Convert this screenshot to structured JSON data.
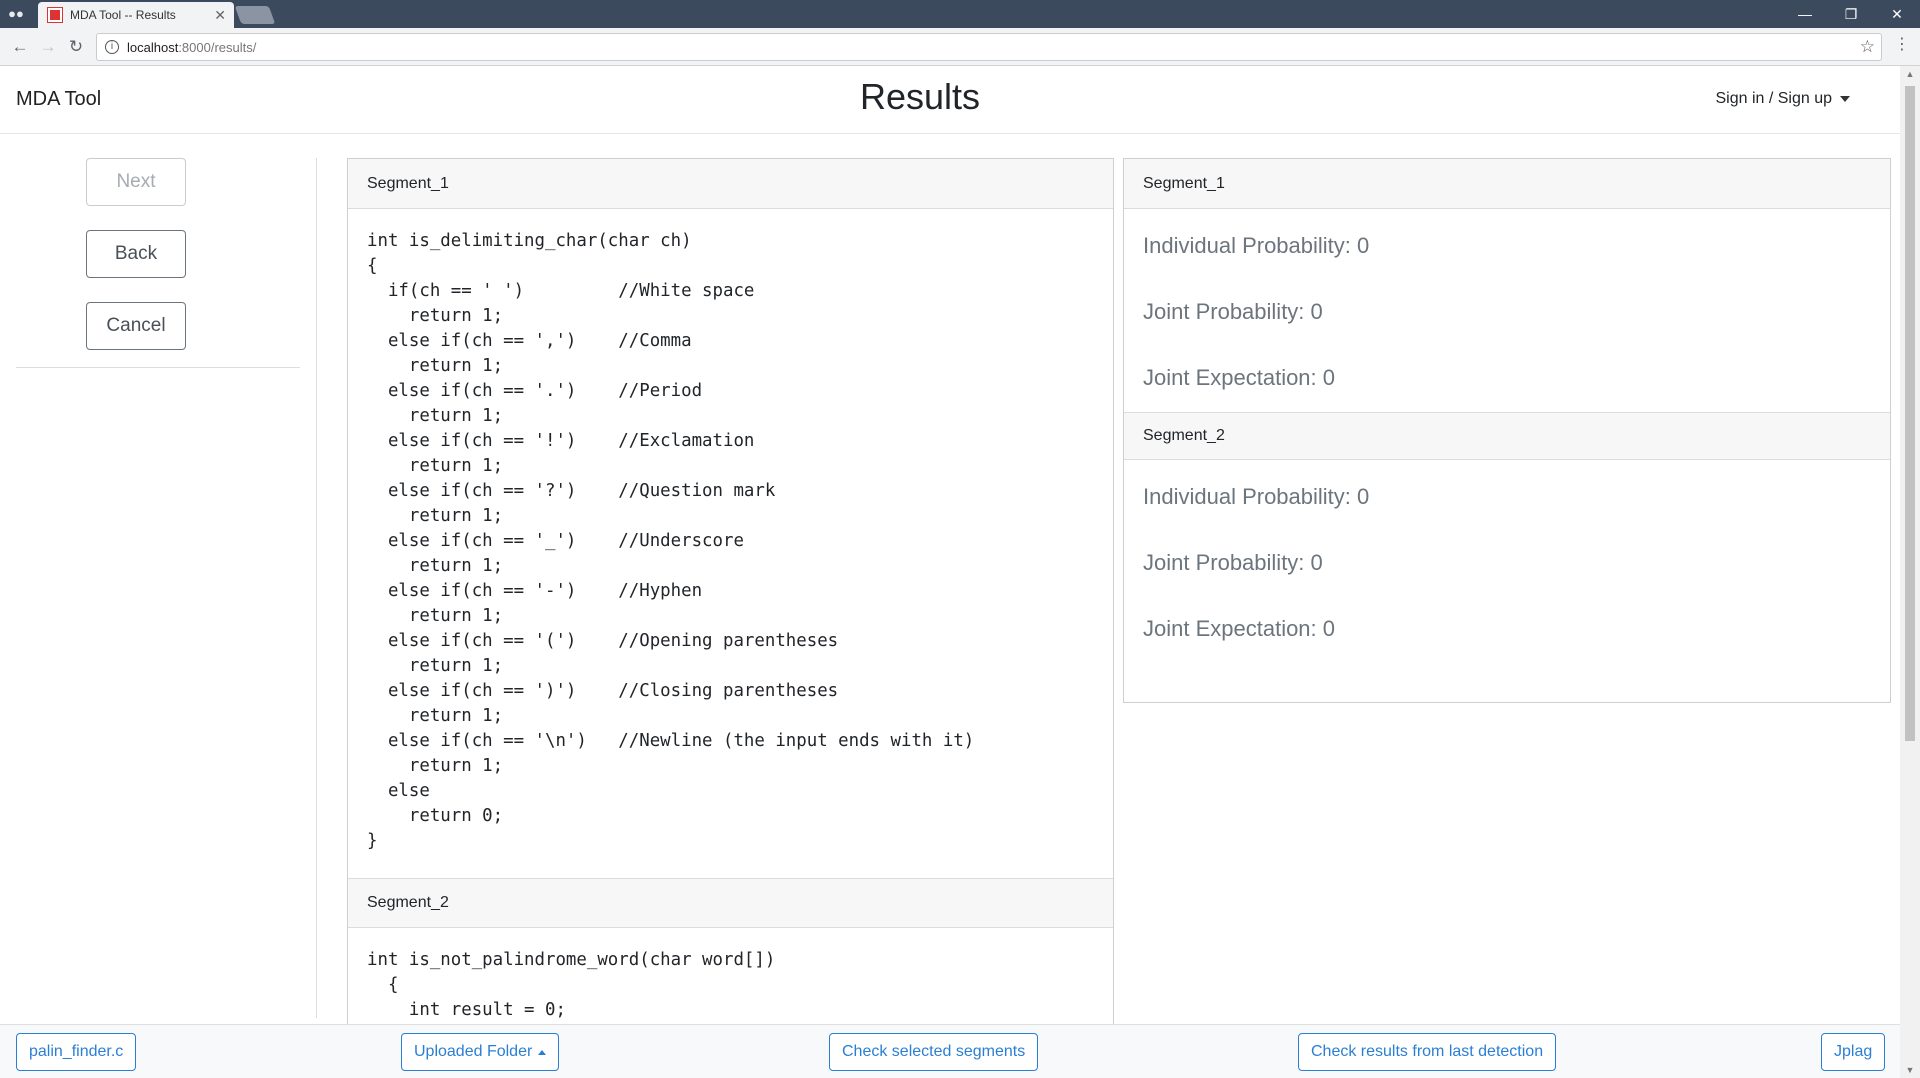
{
  "browser": {
    "tab_title": "MDA Tool -- Results",
    "url_host": "localhost",
    "url_path": ":8000/results/"
  },
  "header": {
    "brand": "MDA Tool",
    "title": "Results",
    "signin": "Sign in / Sign up"
  },
  "sidebar": {
    "next": "Next",
    "back": "Back",
    "cancel": "Cancel"
  },
  "code_panel": {
    "segments": [
      {
        "label": "Segment_1",
        "code": "int is_delimiting_char(char ch)\n{\n  if(ch == ' ')         //White space\n    return 1;\n  else if(ch == ',')    //Comma\n    return 1;\n  else if(ch == '.')    //Period\n    return 1;\n  else if(ch == '!')    //Exclamation\n    return 1;\n  else if(ch == '?')    //Question mark\n    return 1;\n  else if(ch == '_')    //Underscore\n    return 1;\n  else if(ch == '-')    //Hyphen\n    return 1;\n  else if(ch == '(')    //Opening parentheses\n    return 1;\n  else if(ch == ')')    //Closing parentheses\n    return 1;\n  else if(ch == '\\n')   //Newline (the input ends with it)\n    return 1;\n  else\n    return 0;\n}"
      },
      {
        "label": "Segment_2",
        "code": "int is_not_palindrome_word(char word[])\n  {\n    int result = 0;"
      }
    ]
  },
  "results_panel": {
    "segments": [
      {
        "label": "Segment_1",
        "individual": "Individual Probability: 0",
        "joint": "Joint Probability: 0",
        "expectation": "Joint Expectation: 0"
      },
      {
        "label": "Segment_2",
        "individual": "Individual Probability: 0",
        "joint": "Joint Probability: 0",
        "expectation": "Joint Expectation: 0"
      }
    ]
  },
  "bottombar": {
    "file": "palin_finder.c",
    "folder": "Uploaded Folder",
    "check_selected": "Check selected segments",
    "check_last": "Check results from last detection",
    "jplag": "Jplag"
  }
}
